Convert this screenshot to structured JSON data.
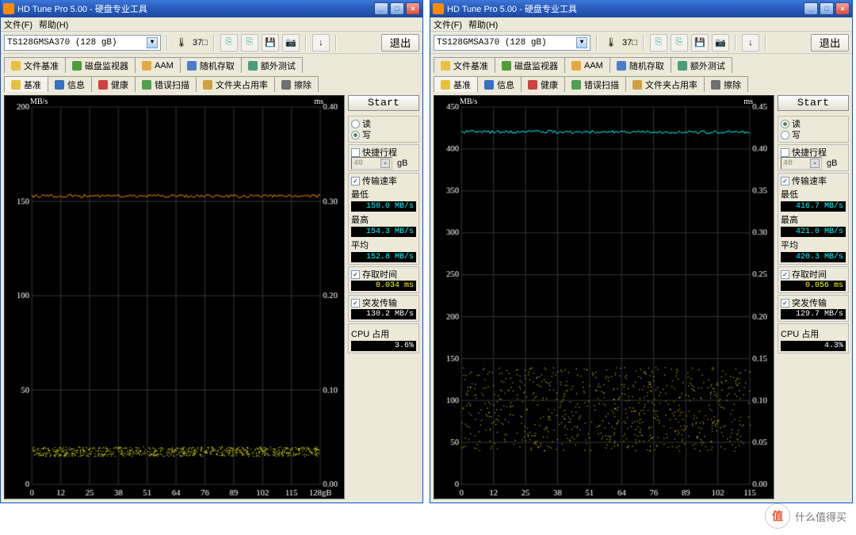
{
  "watermark": "什么值得买",
  "watermark_badge": "值",
  "windows": [
    {
      "title": "HD Tune Pro 5.00 - 硬盘专业工具",
      "menu": {
        "file": "文件(F)",
        "help": "帮助(H)"
      },
      "toolbar": {
        "drive": "TS128GMSA370 (128 gB)",
        "temp": "37□",
        "exit": "退出"
      },
      "tabs_row1": [
        {
          "icon": "file-benchmark-icon",
          "label": "文件基准"
        },
        {
          "icon": "disk-monitor-icon",
          "label": "磁盘监视器"
        },
        {
          "icon": "aam-icon",
          "label": "AAM"
        },
        {
          "icon": "random-access-icon",
          "label": "随机存取"
        },
        {
          "icon": "extra-tests-icon",
          "label": "额外测试"
        }
      ],
      "tabs_row2": [
        {
          "icon": "benchmark-icon",
          "label": "基准",
          "active": true
        },
        {
          "icon": "info-icon",
          "label": "信息"
        },
        {
          "icon": "health-icon",
          "label": "健康"
        },
        {
          "icon": "errorscan-icon",
          "label": "错误扫描"
        },
        {
          "icon": "folder-usage-icon",
          "label": "文件夹占用率"
        },
        {
          "icon": "erase-icon",
          "label": "擦除"
        }
      ],
      "side": {
        "start": "Start",
        "read": "读",
        "write": "写",
        "mode_selected": "write",
        "shortstroke": "快捷行程",
        "stroke_val": "40",
        "stroke_unit": "gB",
        "transfer": "传输速率",
        "min_lbl": "最低",
        "min_val": "150.0 MB/s",
        "max_lbl": "最高",
        "max_val": "154.3 MB/s",
        "avg_lbl": "平均",
        "avg_val": "152.8 MB/s",
        "access_lbl": "存取时间",
        "access_val": "0.034 ms",
        "burst_lbl": "突发传输",
        "burst_val": "130.2 MB/s",
        "cpu_lbl": "CPU 占用",
        "cpu_val": "3.6%"
      },
      "chart_data": {
        "type": "line",
        "xlabel": "gB",
        "ylabel": "MB/s",
        "rlabel": "ms",
        "x_ticks": [
          0,
          12,
          25,
          38,
          51,
          64,
          76,
          89,
          102,
          115,
          "128gB"
        ],
        "y_ticks_left": [
          0,
          50,
          100,
          150,
          200
        ],
        "y_ticks_right": [
          0,
          0.1,
          0.2,
          0.3,
          0.4
        ],
        "ylim_left": [
          0,
          200
        ],
        "ylim_right": [
          0,
          0.4
        ],
        "series": [
          {
            "name": "transfer_rate",
            "color": "#ff8c00",
            "unit": "MB/s",
            "approx_constant": 152.8
          },
          {
            "name": "access_time",
            "color": "#ffff00",
            "unit": "ms",
            "approx_band": [
              0.03,
              0.04
            ]
          }
        ]
      }
    },
    {
      "title": "HD Tune Pro 5.00 - 硬盘专业工具",
      "menu": {
        "file": "文件(F)",
        "help": "帮助(H)"
      },
      "toolbar": {
        "drive": "TS128GMSA370 (128 gB)",
        "temp": "37□",
        "exit": "退出"
      },
      "tabs_row1": [
        {
          "icon": "file-benchmark-icon",
          "label": "文件基准"
        },
        {
          "icon": "disk-monitor-icon",
          "label": "磁盘监视器"
        },
        {
          "icon": "aam-icon",
          "label": "AAM"
        },
        {
          "icon": "random-access-icon",
          "label": "随机存取"
        },
        {
          "icon": "extra-tests-icon",
          "label": "额外测试"
        }
      ],
      "tabs_row2": [
        {
          "icon": "benchmark-icon",
          "label": "基准",
          "active": true
        },
        {
          "icon": "info-icon",
          "label": "信息"
        },
        {
          "icon": "health-icon",
          "label": "健康"
        },
        {
          "icon": "errorscan-icon",
          "label": "错误扫描"
        },
        {
          "icon": "folder-usage-icon",
          "label": "文件夹占用率"
        },
        {
          "icon": "erase-icon",
          "label": "擦除"
        }
      ],
      "side": {
        "start": "Start",
        "read": "读",
        "write": "写",
        "mode_selected": "read",
        "shortstroke": "快捷行程",
        "stroke_val": "40",
        "stroke_unit": "gB",
        "transfer": "传输速率",
        "min_lbl": "最低",
        "min_val": "416.7 MB/s",
        "max_lbl": "最高",
        "max_val": "421.0 MB/s",
        "avg_lbl": "平均",
        "avg_val": "420.3 MB/s",
        "access_lbl": "存取时间",
        "access_val": "0.056 ms",
        "burst_lbl": "突发传输",
        "burst_val": "129.7 MB/s",
        "cpu_lbl": "CPU 占用",
        "cpu_val": "4.3%"
      },
      "chart_data": {
        "type": "line",
        "xlabel": "gB",
        "ylabel": "MB/s",
        "rlabel": "ms",
        "x_ticks": [
          0,
          12,
          25,
          38,
          51,
          64,
          76,
          89,
          102,
          115
        ],
        "y_ticks_left": [
          0,
          50,
          100,
          150,
          200,
          250,
          300,
          350,
          400,
          450
        ],
        "y_ticks_right": [
          0,
          0.05,
          0.1,
          0.15,
          0.2,
          0.25,
          0.3,
          0.35,
          0.4,
          0.45
        ],
        "ylim_left": [
          0,
          450
        ],
        "ylim_right": [
          0,
          0.45
        ],
        "series": [
          {
            "name": "transfer_rate",
            "color": "#00ffff",
            "unit": "MB/s",
            "approx_constant": 420.3
          },
          {
            "name": "access_time",
            "color": "#ffff00",
            "unit": "ms",
            "approx_band": [
              0.04,
              0.14
            ]
          }
        ]
      }
    }
  ]
}
